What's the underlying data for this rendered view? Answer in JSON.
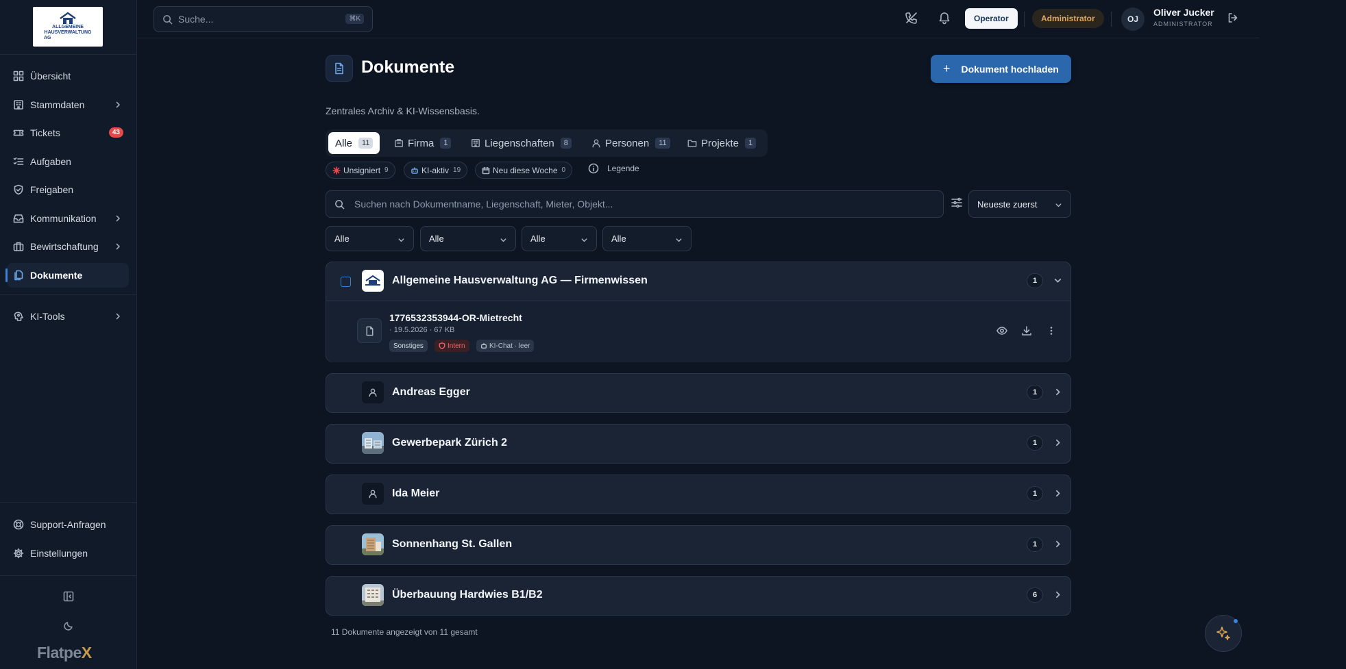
{
  "sidebar": {
    "logo_text": [
      "ALLGEMEINE",
      "HAUSVERWALTUNG",
      "AG"
    ],
    "items": [
      {
        "label": "Übersicht",
        "icon": "grid-icon"
      },
      {
        "label": "Stammdaten",
        "icon": "building-icon",
        "has_children": true
      },
      {
        "label": "Tickets",
        "icon": "ticket-icon",
        "badge": "43"
      },
      {
        "label": "Aufgaben",
        "icon": "list-check-icon"
      },
      {
        "label": "Freigaben",
        "icon": "shield-check-icon"
      },
      {
        "label": "Kommunikation",
        "icon": "inbox-icon",
        "has_children": true
      },
      {
        "label": "Bewirtschaftung",
        "icon": "briefcase-icon",
        "has_children": true
      },
      {
        "label": "Dokumente",
        "icon": "files-icon",
        "active": true
      },
      {
        "label": "KI-Tools",
        "icon": "brain-icon",
        "has_children": true
      }
    ],
    "bottom_items": [
      {
        "label": "Support-Anfragen",
        "icon": "lifebuoy-icon"
      },
      {
        "label": "Einstellungen",
        "icon": "gear-icon"
      }
    ],
    "brand_main": "Flatpe",
    "brand_accent": "X"
  },
  "topbar": {
    "search_placeholder": "Suche...",
    "search_shortcut": "⌘K",
    "operator_label": "Operator",
    "admin_label": "Administrator",
    "user_initials": "OJ",
    "user_name": "Oliver Jucker",
    "user_role": "ADMINISTRATOR"
  },
  "page": {
    "title": "Dokumente",
    "subtitle": "Zentrales Archiv & KI-Wissensbasis.",
    "upload_label": "Dokument hochladen",
    "tabs": [
      {
        "label": "Alle",
        "count": "11",
        "active": true
      },
      {
        "label": "Firma",
        "count": "1",
        "icon": "building-icon"
      },
      {
        "label": "Liegenschaften",
        "count": "8",
        "icon": "buildings-icon"
      },
      {
        "label": "Personen",
        "count": "11",
        "icon": "user-icon"
      },
      {
        "label": "Projekte",
        "count": "1",
        "icon": "folder-icon"
      }
    ],
    "chips": [
      {
        "label": "Unsigniert",
        "count": "9",
        "icon": "signature-icon",
        "color": "#e5484d"
      },
      {
        "label": "KI-aktiv",
        "count": "19",
        "icon": "robot-icon",
        "color": "#6aa5ea"
      },
      {
        "label": "Neu diese Woche",
        "count": "0",
        "icon": "calendar-icon",
        "color": "#aab4c3"
      }
    ],
    "legend_label": "Legende",
    "search_placeholder": "Suchen nach Dokumentname, Liegenschaft, Mieter, Objekt...",
    "sort_value": "Neueste zuerst",
    "filters": [
      "Alle",
      "Alle",
      "Alle",
      "Alle"
    ],
    "groups": [
      {
        "title": "Allgemeine Hausverwaltung AG — Firmenwissen",
        "count": "1",
        "thumb": "company-logo",
        "expanded": true,
        "documents": [
          {
            "name": "1776532353944-OR-Mietrecht",
            "meta": "· 19.5.2026 · 67 KB",
            "tags": [
              {
                "label": "Sonstiges",
                "kind": "neutral"
              },
              {
                "label": "Intern",
                "kind": "danger",
                "icon": "shield-icon"
              },
              {
                "label": "KI-Chat · leer",
                "kind": "neutral",
                "icon": "robot-icon"
              }
            ]
          }
        ]
      },
      {
        "title": "Andreas Egger",
        "count": "1",
        "thumb": "person"
      },
      {
        "title": "Gewerbepark Zürich 2",
        "count": "1",
        "thumb": "property"
      },
      {
        "title": "Ida Meier",
        "count": "1",
        "thumb": "person"
      },
      {
        "title": "Sonnenhang St. Gallen",
        "count": "1",
        "thumb": "property"
      },
      {
        "title": "Überbauung Hardwies B1/B2",
        "count": "6",
        "thumb": "property"
      }
    ],
    "footer": "11 Dokumente angezeigt von 11 gesamt"
  }
}
